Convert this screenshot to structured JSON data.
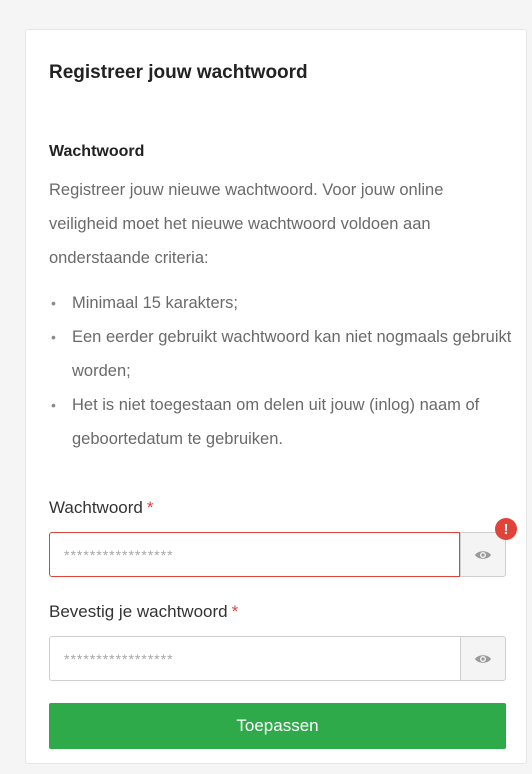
{
  "card": {
    "title": "Registreer jouw wachtwoord",
    "section_title": "Wachtwoord",
    "intro": "Registreer jouw nieuwe wachtwoord. Voor jouw online veiligheid moet het nieuwe wachtwoord voldoen aan onderstaande criteria:",
    "criteria": [
      "Minimaal 15 karakters;",
      "Een eerder gebruikt wachtwoord kan niet nogmaals gebruikt worden;",
      "Het is niet toegestaan om delen uit jouw (inlog) naam of geboortedatum te gebruiken."
    ]
  },
  "password_field": {
    "label": "Wachtwoord",
    "required_mark": "*",
    "placeholder": "*****************",
    "value": "",
    "state": "error",
    "error_icon": "exclamation-icon",
    "error_symbol": "!",
    "toggle_icon": "eye-icon"
  },
  "confirm_field": {
    "label": "Bevestig je wachtwoord",
    "required_mark": "*",
    "placeholder": "*****************",
    "value": "",
    "toggle_icon": "eye-icon"
  },
  "submit": {
    "label": "Toepassen"
  },
  "colors": {
    "primary_button": "#2eaa4a",
    "error": "#e0433a",
    "muted_text": "#6a6a6a"
  }
}
